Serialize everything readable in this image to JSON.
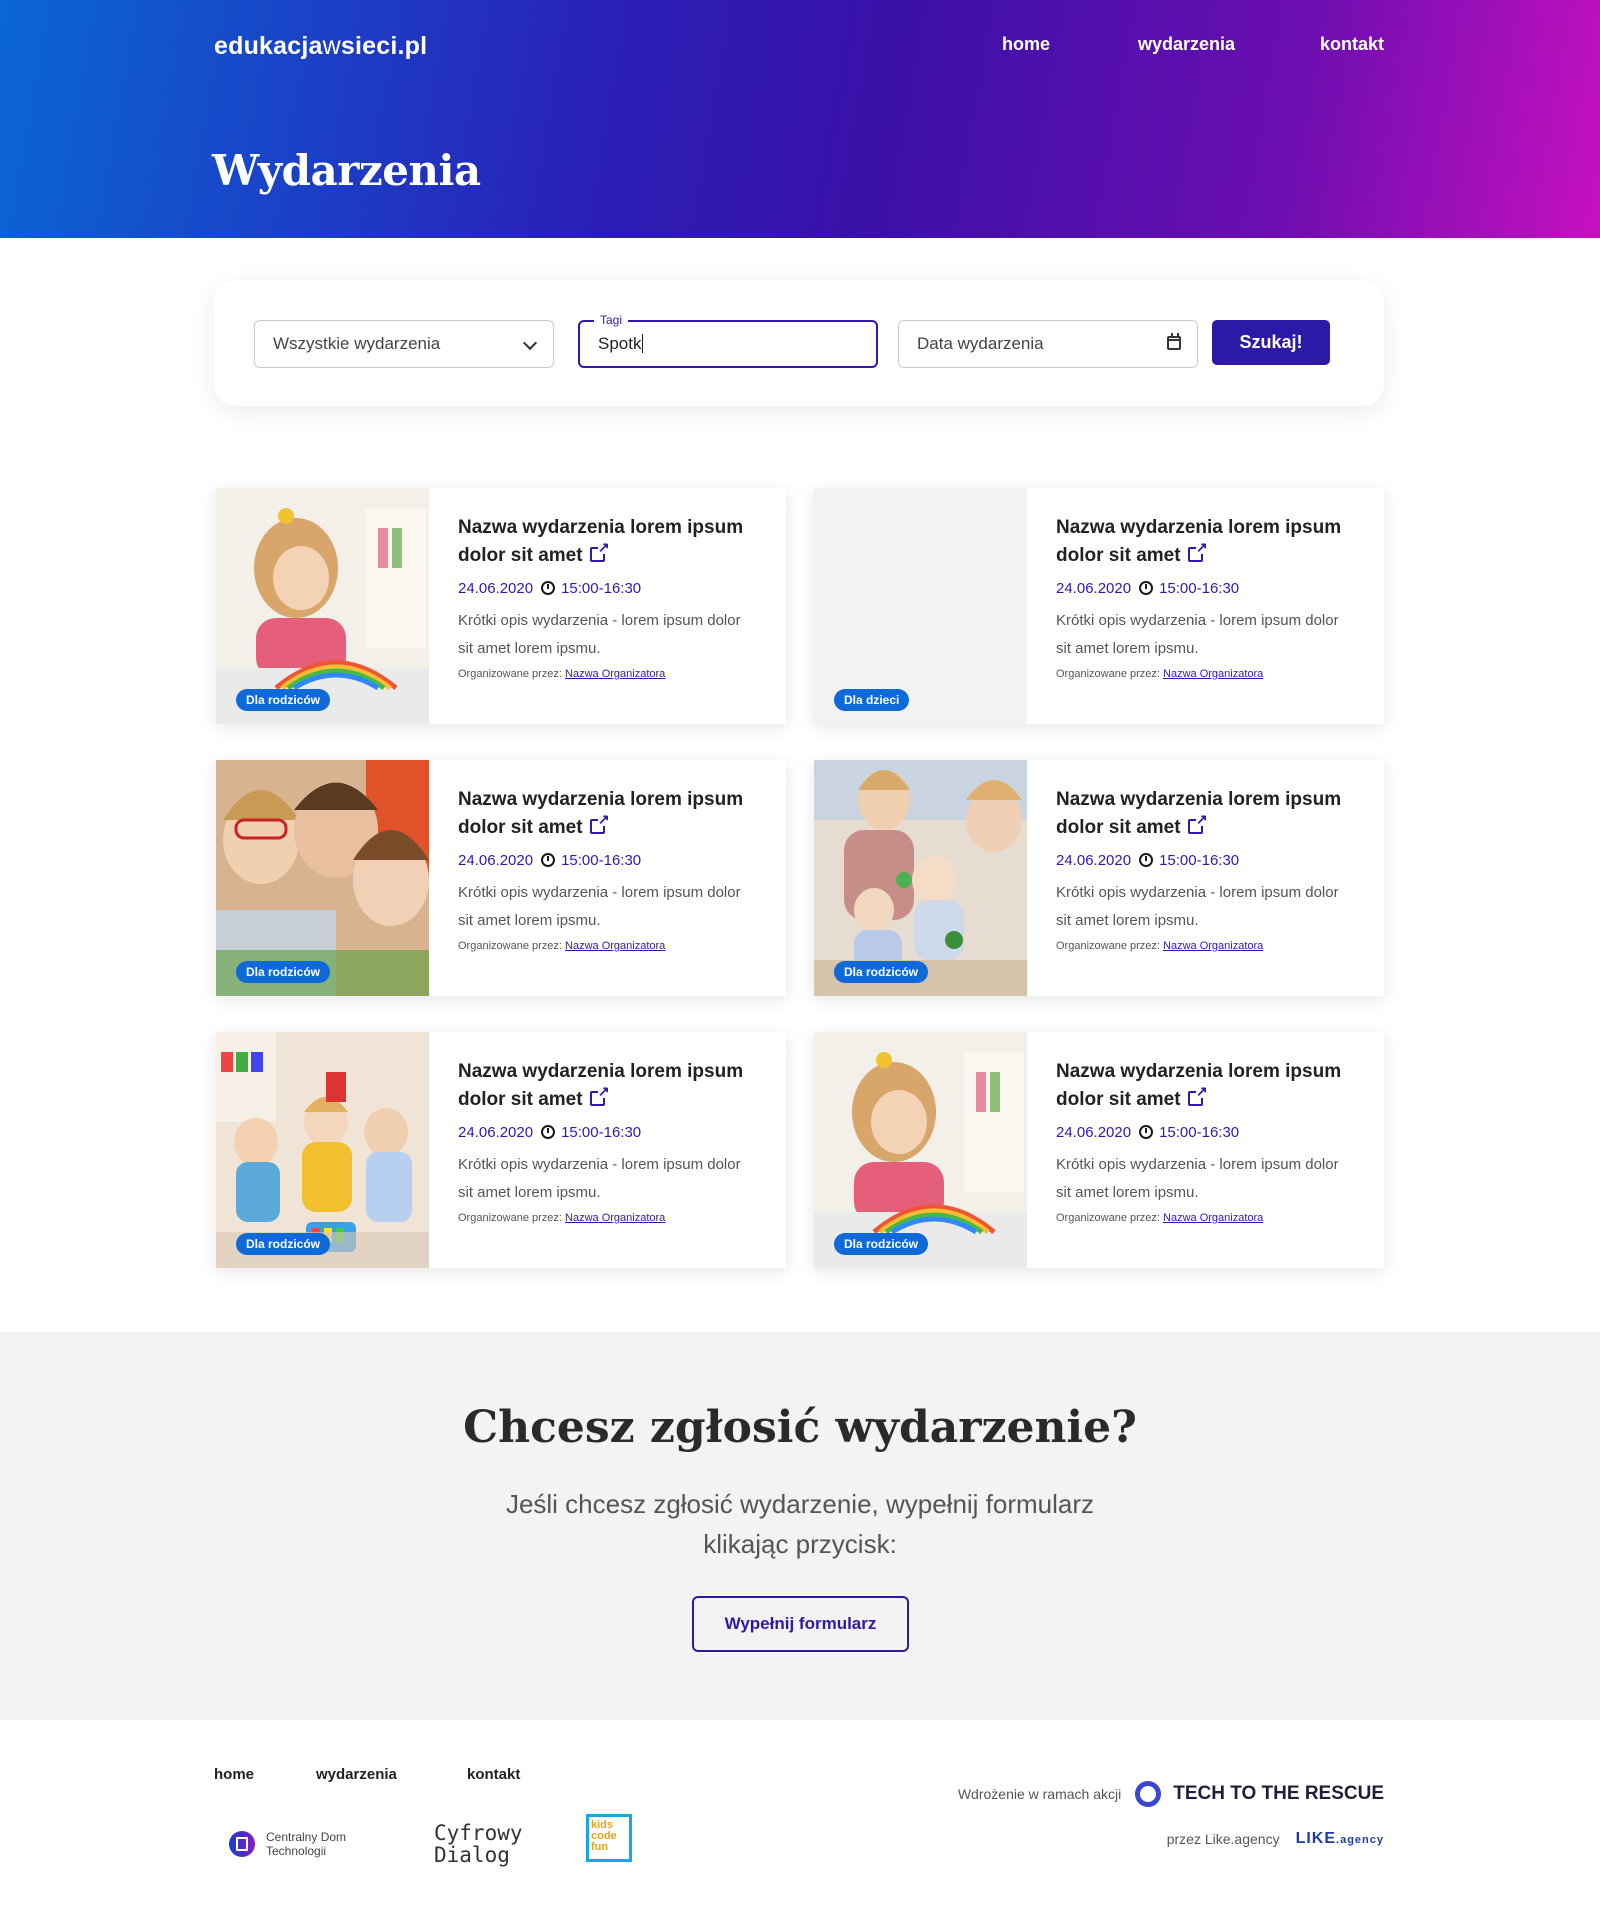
{
  "header": {
    "logo_part1": "edukacja",
    "logo_part2": "w",
    "logo_part3": "sieci.pl",
    "nav": [
      "home",
      "wydarzenia",
      "kontakt"
    ],
    "page_title": "Wydarzenia"
  },
  "filter": {
    "category_value": "Wszystkie wydarzenia",
    "tags_label": "Tagi",
    "tags_value": "Spotk",
    "date_placeholder": "Data wydarzenia",
    "search_label": "Szukaj!"
  },
  "events": [
    {
      "title": "Nazwa wydarzenia lorem ipsum dolor sit amet",
      "date": "24.06.2020",
      "time": "15:00-16:30",
      "desc": "Krótki opis wydarzenia - lorem ipsum dolor sit amet lorem ipsmu.",
      "org_label": "Organizowane przez:",
      "org_name": "Nazwa Organizatora",
      "badge": "Dla rodziców"
    },
    {
      "title": "Nazwa wydarzenia lorem ipsum dolor sit amet",
      "date": "24.06.2020",
      "time": "15:00-16:30",
      "desc": "Krótki opis wydarzenia - lorem ipsum dolor sit amet lorem ipsmu.",
      "org_label": "Organizowane przez:",
      "org_name": "Nazwa Organizatora",
      "badge": "Dla dzieci"
    },
    {
      "title": "Nazwa wydarzenia lorem ipsum dolor sit amet",
      "date": "24.06.2020",
      "time": "15:00-16:30",
      "desc": "Krótki opis wydarzenia - lorem ipsum dolor sit amet lorem ipsmu.",
      "org_label": "Organizowane przez:",
      "org_name": "Nazwa Organizatora",
      "badge": "Dla rodziców"
    },
    {
      "title": "Nazwa wydarzenia lorem ipsum dolor sit amet",
      "date": "24.06.2020",
      "time": "15:00-16:30",
      "desc": "Krótki opis wydarzenia - lorem ipsum dolor sit amet lorem ipsmu.",
      "org_label": "Organizowane przez:",
      "org_name": "Nazwa Organizatora",
      "badge": "Dla rodziców"
    },
    {
      "title": "Nazwa wydarzenia lorem ipsum dolor sit amet",
      "date": "24.06.2020",
      "time": "15:00-16:30",
      "desc": "Krótki opis wydarzenia - lorem ipsum dolor sit amet lorem ipsmu.",
      "org_label": "Organizowane przez:",
      "org_name": "Nazwa Organizatora",
      "badge": "Dla rodziców"
    },
    {
      "title": "Nazwa wydarzenia lorem ipsum dolor sit amet",
      "date": "24.06.2020",
      "time": "15:00-16:30",
      "desc": "Krótki opis wydarzenia - lorem ipsum dolor sit amet lorem ipsmu.",
      "org_label": "Organizowane przez:",
      "org_name": "Nazwa Organizatora",
      "badge": "Dla rodziców"
    }
  ],
  "cta": {
    "title": "Chcesz zgłosić wydarzenie?",
    "text": "Jeśli chcesz zgłosić wydarzenie, wypełnij formularz klikając przycisk:",
    "button": "Wypełnij formularz"
  },
  "footer": {
    "nav": [
      "home",
      "wydarzenia",
      "kontakt"
    ],
    "action_text": "Wdrożenie w ramach akcji",
    "action_name": "TECH TO THE RESCUE",
    "by_text": "przez Like.agency",
    "partners": [
      "Centralny Dom Technologii",
      "Cyfrowy Dialog",
      "kids code fun"
    ]
  },
  "colors": {
    "accent": "#2c1aa6",
    "badge": "#0f6ad8",
    "gradient_start": "#0a66d6",
    "gradient_end": "#c610c0"
  }
}
